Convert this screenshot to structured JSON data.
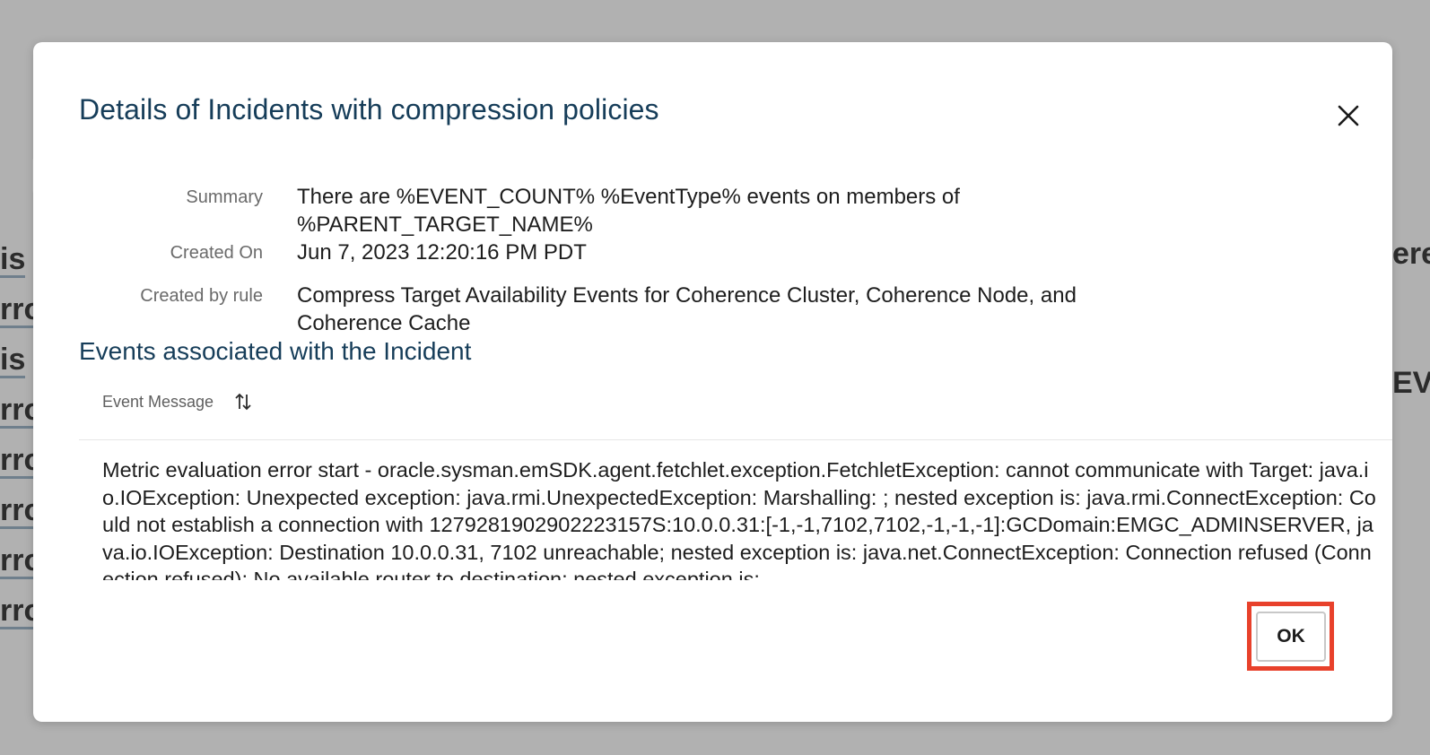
{
  "background": {
    "left_fragments": [
      "is",
      "rro",
      "is",
      "rro",
      "rro",
      "rro",
      "rro",
      "rro"
    ],
    "right_fragments": [
      "eren",
      "EVE"
    ]
  },
  "dialog": {
    "title": "Details of Incidents with compression policies",
    "close_icon": "close-icon",
    "details": [
      {
        "label": "Summary",
        "value": "There are %EVENT_COUNT% %EventType% events on members of %PARENT_TARGET_NAME%"
      },
      {
        "label": "Created On",
        "value": "Jun 7, 2023 12:20:16 PM PDT"
      },
      {
        "label": "Created by rule",
        "value": "Compress Target Availability Events for Coherence Cluster, Coherence Node, and Coherence Cache"
      }
    ],
    "events_section": {
      "title": "Events associated with the Incident",
      "column_header": "Event Message",
      "sort_icon": "sort-icon",
      "rows": [
        "Metric evaluation error start - oracle.sysman.emSDK.agent.fetchlet.exception.FetchletException: cannot communicate with Target: java.io.IOException: Unexpected exception: java.rmi.UnexpectedException: Marshalling: ; nested exception is: java.rmi.ConnectException: Could not establish a connection with 1279281902902223157S:10.0.0.31:[-1,-1,7102,7102,-1,-1,-1]:GCDomain:EMGC_ADMINSERVER, java.io.IOException: Destination 10.0.0.31, 7102 unreachable; nested exception is: java.net.ConnectException: Connection refused (Connection refused); No available router to destination; nested exception is:"
      ]
    },
    "ok_label": "OK",
    "highlight_color": "#e8412b"
  }
}
